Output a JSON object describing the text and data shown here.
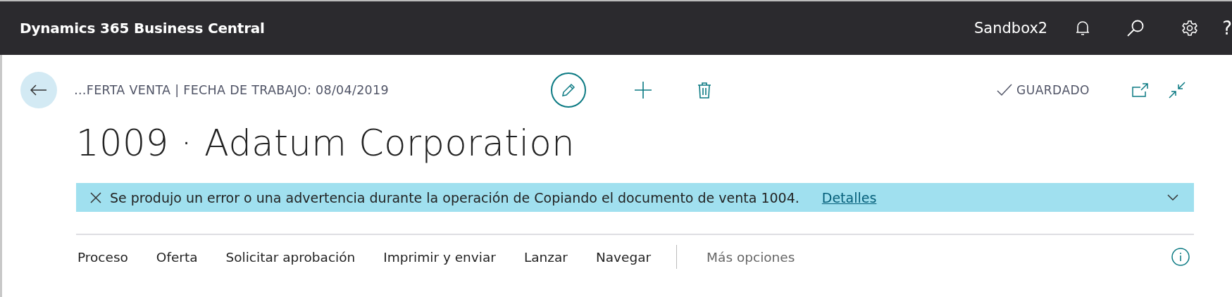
{
  "top_bar": {
    "app_title": "Dynamics 365 Business Central",
    "environment": "Sandbox2",
    "help_glyph": "?"
  },
  "header": {
    "breadcrumb": "…FERTA VENTA | FECHA DE TRABAJO: 08/04/2019",
    "status": "GUARDADO",
    "title": "1009 · Adatum Corporation"
  },
  "banner": {
    "message": "Se produjo un error o una advertencia durante la operación de Copiando el documento de venta 1004.",
    "link": "Detalles"
  },
  "actions": [
    {
      "label": "Proceso",
      "kind": "menu"
    },
    {
      "label": "Oferta",
      "kind": "menu"
    },
    {
      "label": "Solicitar aprobación",
      "kind": "menu"
    },
    {
      "label": "Imprimir y enviar",
      "kind": "menu"
    },
    {
      "label": "Lanzar",
      "kind": "menu"
    },
    {
      "label": "Navegar",
      "kind": "menu"
    },
    {
      "label": "Más opciones",
      "kind": "more"
    }
  ]
}
